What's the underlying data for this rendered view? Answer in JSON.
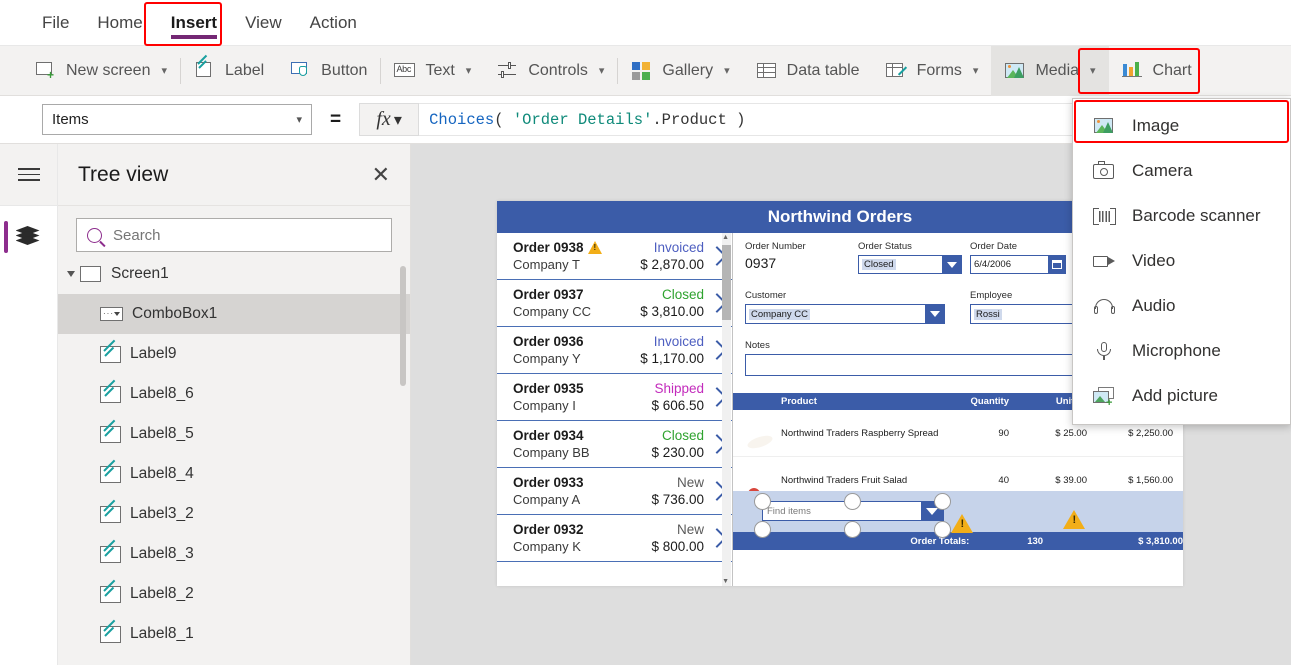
{
  "menubar": {
    "items": [
      {
        "label": "File",
        "active": false
      },
      {
        "label": "Home",
        "active": false
      },
      {
        "label": "Insert",
        "active": true
      },
      {
        "label": "View",
        "active": false
      },
      {
        "label": "Action",
        "active": false
      }
    ]
  },
  "ribbon": {
    "items": [
      {
        "label": "New screen",
        "icon": "new-screen-icon",
        "caret": true
      },
      {
        "label": "Label",
        "icon": "label-icon",
        "caret": false
      },
      {
        "label": "Button",
        "icon": "button-icon",
        "caret": false
      },
      {
        "label": "Text",
        "icon": "text-abc-icon",
        "caret": true
      },
      {
        "label": "Controls",
        "icon": "controls-sliders-icon",
        "caret": true
      },
      {
        "label": "Gallery",
        "icon": "gallery-icon",
        "caret": true
      },
      {
        "label": "Data table",
        "icon": "data-table-icon",
        "caret": false
      },
      {
        "label": "Forms",
        "icon": "forms-icon",
        "caret": true
      },
      {
        "label": "Media",
        "icon": "media-image-icon",
        "caret": true
      },
      {
        "label": "Chart",
        "icon": "chart-icon",
        "caret": false
      }
    ]
  },
  "formula_bar": {
    "property": "Items",
    "equals": "=",
    "fx": "fx",
    "formula_fn": "Choices",
    "formula_open": "( ",
    "formula_string": "'Order Details'",
    "formula_tail": ".Product )"
  },
  "tree_panel": {
    "title": "Tree view",
    "close_label": "✕",
    "search_placeholder": "Search",
    "nodes": [
      {
        "label": "Screen1",
        "icon": "screen-icon",
        "level": 0,
        "selected": false,
        "expanded": true
      },
      {
        "label": "ComboBox1",
        "icon": "combobox-icon",
        "level": 1,
        "selected": true
      },
      {
        "label": "Label9",
        "icon": "label-icon",
        "level": 1,
        "selected": false
      },
      {
        "label": "Label8_6",
        "icon": "label-icon",
        "level": 1,
        "selected": false
      },
      {
        "label": "Label8_5",
        "icon": "label-icon",
        "level": 1,
        "selected": false
      },
      {
        "label": "Label8_4",
        "icon": "label-icon",
        "level": 1,
        "selected": false
      },
      {
        "label": "Label3_2",
        "icon": "label-icon",
        "level": 1,
        "selected": false
      },
      {
        "label": "Label8_3",
        "icon": "label-icon",
        "level": 1,
        "selected": false
      },
      {
        "label": "Label8_2",
        "icon": "label-icon",
        "level": 1,
        "selected": false
      },
      {
        "label": "Label8_1",
        "icon": "label-icon",
        "level": 1,
        "selected": false
      }
    ]
  },
  "media_menu": {
    "items": [
      {
        "label": "Image",
        "icon": "image-icon",
        "highlighted": true
      },
      {
        "label": "Camera",
        "icon": "camera-icon",
        "highlighted": false
      },
      {
        "label": "Barcode scanner",
        "icon": "barcode-scanner-icon",
        "highlighted": false
      },
      {
        "label": "Video",
        "icon": "video-icon",
        "highlighted": false
      },
      {
        "label": "Audio",
        "icon": "audio-headphones-icon",
        "highlighted": false
      },
      {
        "label": "Microphone",
        "icon": "microphone-icon",
        "highlighted": false
      },
      {
        "label": "Add picture",
        "icon": "add-picture-icon",
        "highlighted": false
      }
    ]
  },
  "app_preview": {
    "title": "Northwind Orders",
    "gallery": [
      {
        "order": "Order 0938",
        "company": "Company T",
        "status": "Invoiced",
        "amount": "$ 2,870.00",
        "status_color": "#4d5ec0",
        "warn": true
      },
      {
        "order": "Order 0937",
        "company": "Company CC",
        "status": "Closed",
        "amount": "$ 3,810.00",
        "status_color": "#2fa32f",
        "warn": false
      },
      {
        "order": "Order 0936",
        "company": "Company Y",
        "status": "Invoiced",
        "amount": "$ 1,170.00",
        "status_color": "#4d5ec0",
        "warn": false
      },
      {
        "order": "Order 0935",
        "company": "Company I",
        "status": "Shipped",
        "amount": "$ 606.50",
        "status_color": "#c32bbc",
        "warn": false
      },
      {
        "order": "Order 0934",
        "company": "Company BB",
        "status": "Closed",
        "amount": "$ 230.00",
        "status_color": "#2fa32f",
        "warn": false
      },
      {
        "order": "Order 0933",
        "company": "Company A",
        "status": "New",
        "amount": "$ 736.00",
        "status_color": "#5a5a5a",
        "warn": false
      },
      {
        "order": "Order 0932",
        "company": "Company K",
        "status": "New",
        "amount": "$ 800.00",
        "status_color": "#5a5a5a",
        "warn": false
      }
    ],
    "detail": {
      "order_number_label": "Order Number",
      "order_number_value": "0937",
      "order_status_label": "Order Status",
      "order_status_value": "Closed",
      "order_date_label": "Order Date",
      "order_date_value": "6/4/2006",
      "customer_label": "Customer",
      "customer_value": "Company CC",
      "employee_label": "Employee",
      "employee_value": "Rossi",
      "notes_label": "Notes",
      "notes_value": ""
    },
    "product_table": {
      "headers": [
        "Product",
        "Quantity",
        "Unit Pr",
        ""
      ],
      "rows": [
        {
          "name": "Northwind Traders Raspberry Spread",
          "quantity": "90",
          "unit_price": "$ 25.00",
          "total": "$ 2,250.00"
        },
        {
          "name": "Northwind Traders Fruit Salad",
          "quantity": "40",
          "unit_price": "$ 39.00",
          "total": "$ 1,560.00"
        }
      ]
    },
    "combobox_placeholder": "Find items",
    "totals": {
      "label": "Order Totals:",
      "quantity": "130",
      "amount": "$ 3,810.00"
    }
  },
  "colors": {
    "accent_purple": "#742774",
    "app_blue": "#3b5ca8",
    "annotation_red": "#ff0000",
    "ribbon_bg": "#f3f2f1"
  }
}
